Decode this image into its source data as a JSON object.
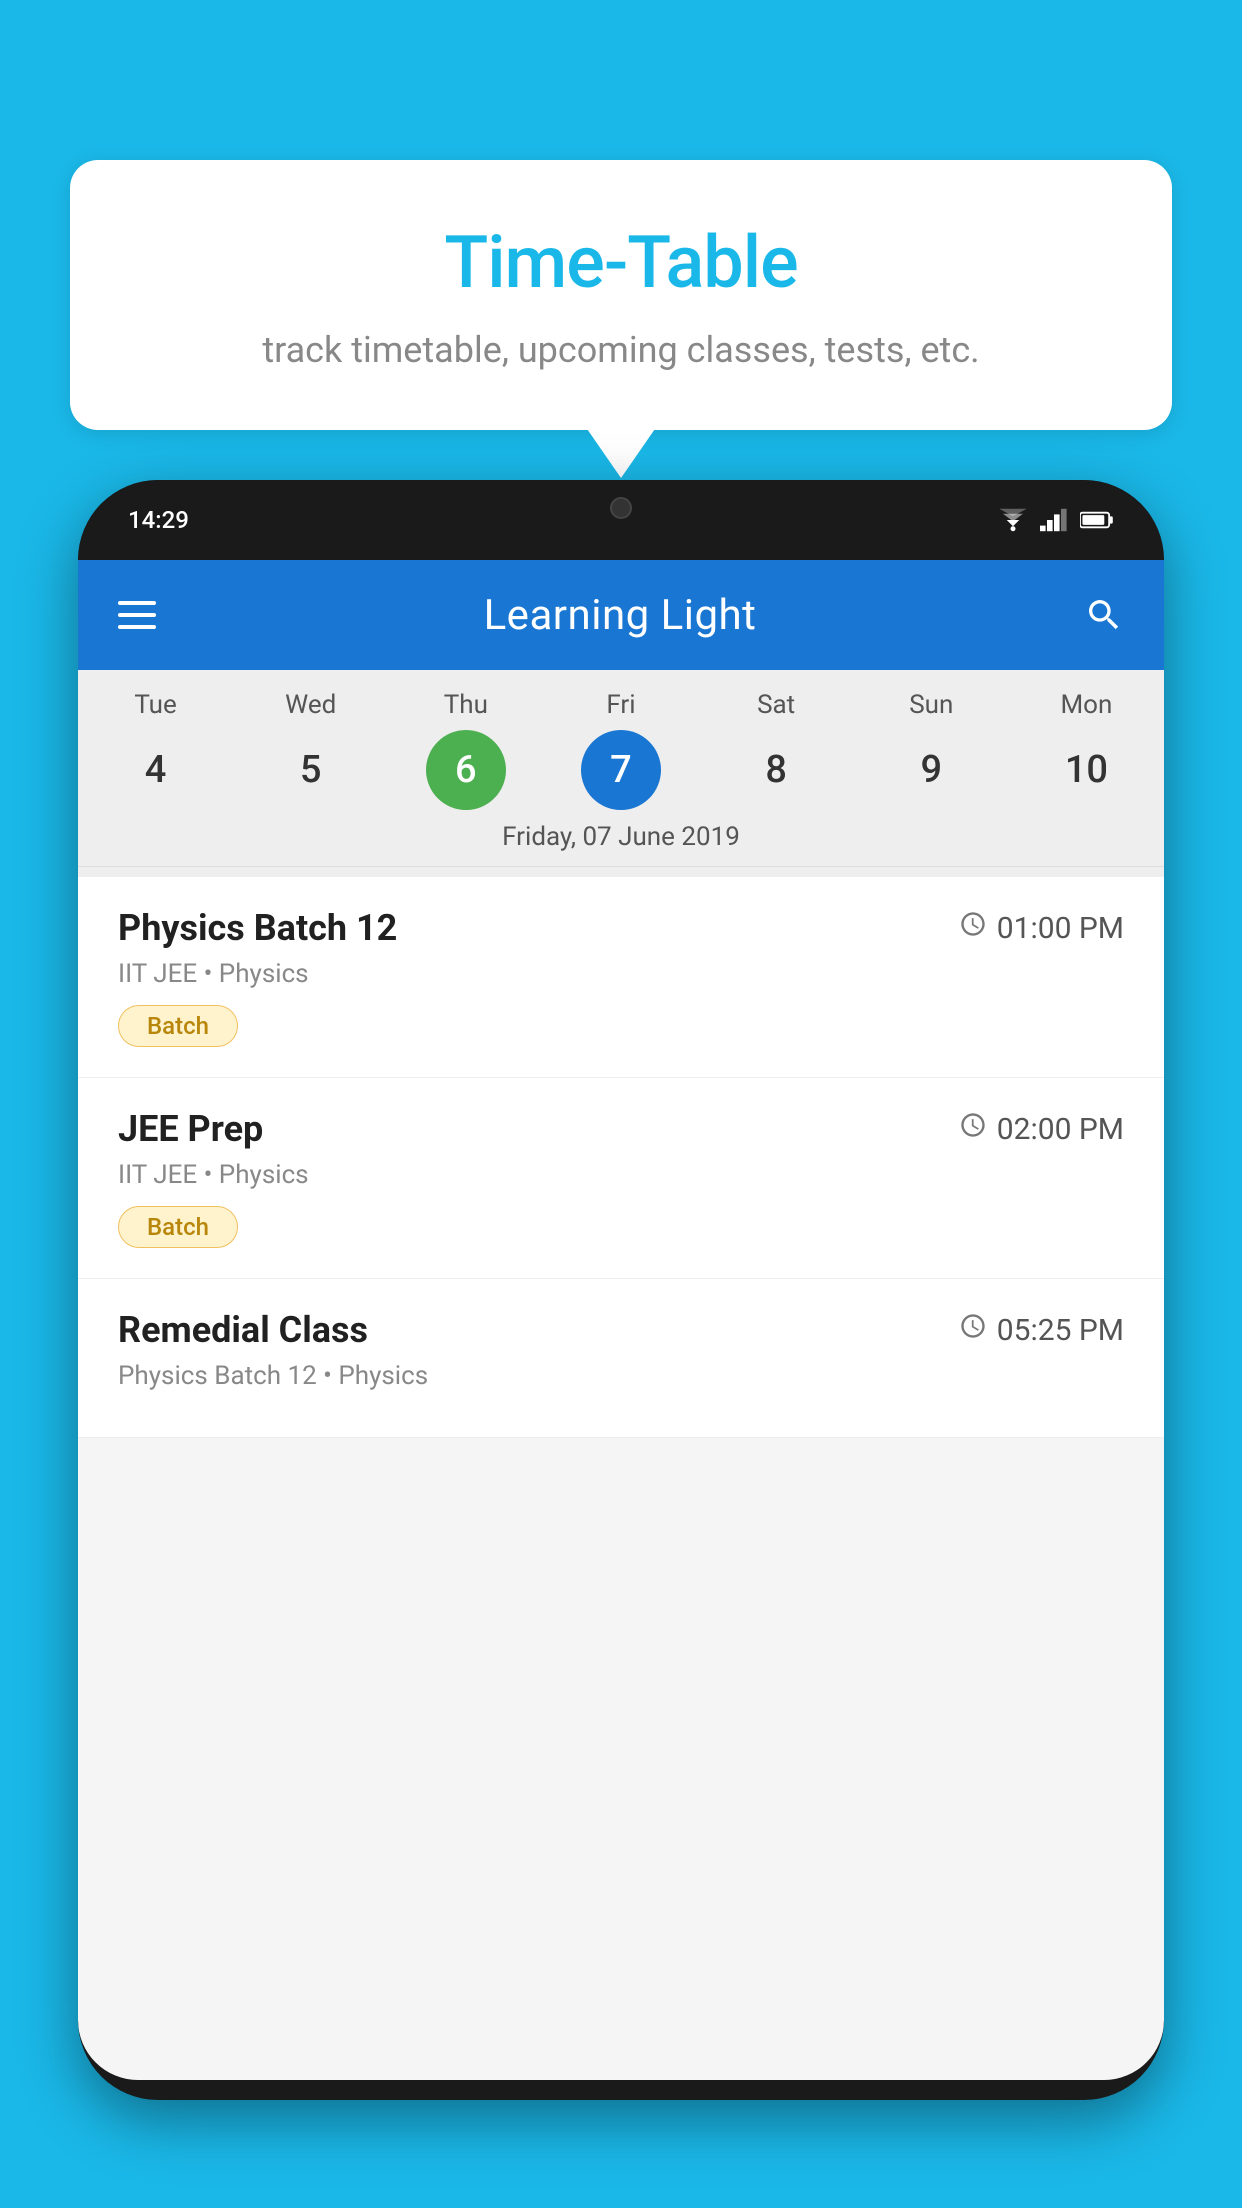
{
  "background_color": "#1ab8e8",
  "tooltip": {
    "title": "Time-Table",
    "subtitle": "track timetable, upcoming classes, tests, etc."
  },
  "phone": {
    "status_bar": {
      "time": "14:29"
    },
    "app_header": {
      "title": "Learning Light"
    },
    "calendar": {
      "days": [
        "Tue",
        "Wed",
        "Thu",
        "Fri",
        "Sat",
        "Sun",
        "Mon"
      ],
      "dates": [
        "4",
        "5",
        "6",
        "7",
        "8",
        "9",
        "10"
      ],
      "today_index": 2,
      "selected_index": 3,
      "selected_label": "Friday, 07 June 2019"
    },
    "schedule": [
      {
        "title": "Physics Batch 12",
        "time": "01:00 PM",
        "subtitle": "IIT JEE • Physics",
        "badge": "Batch"
      },
      {
        "title": "JEE Prep",
        "time": "02:00 PM",
        "subtitle": "IIT JEE • Physics",
        "badge": "Batch"
      },
      {
        "title": "Remedial Class",
        "time": "05:25 PM",
        "subtitle": "Physics Batch 12 • Physics",
        "badge": ""
      }
    ]
  }
}
